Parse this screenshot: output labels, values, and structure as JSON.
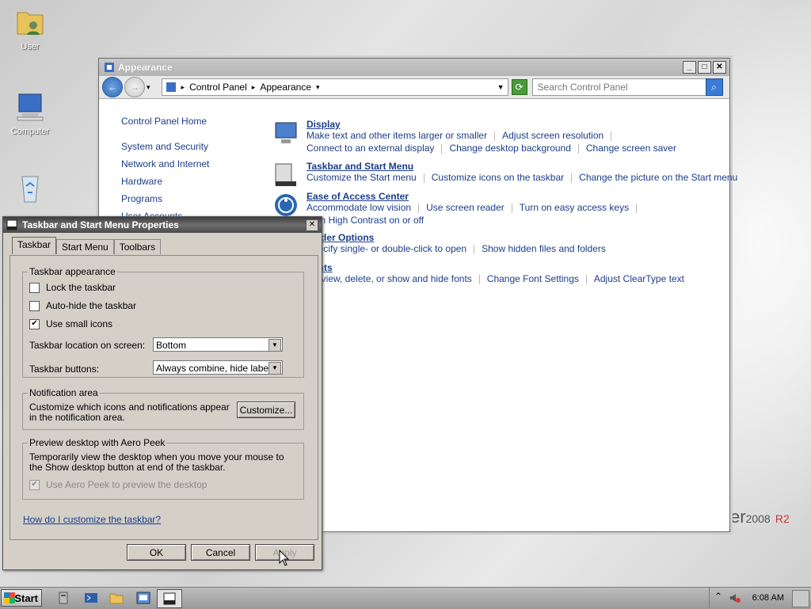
{
  "desktop": {
    "icons": [
      {
        "label": "User"
      },
      {
        "label": "Computer"
      },
      {
        "label": "Recycle Bin"
      }
    ],
    "brand": {
      "text": "er",
      "version": "2008",
      "edition": "R2"
    }
  },
  "control_panel": {
    "title": "Appearance",
    "breadcrumb": [
      "Control Panel",
      "Appearance"
    ],
    "search_placeholder": "Search Control Panel",
    "left_nav": {
      "home": "Control Panel Home",
      "items": [
        "System and Security",
        "Network and Internet",
        "Hardware",
        "Programs",
        "User Accounts"
      ]
    },
    "categories": [
      {
        "title": "Display",
        "rows": [
          [
            "Make text and other items larger or smaller",
            "Adjust screen resolution"
          ],
          [
            "Connect to an external display",
            "Change desktop background",
            "Change screen saver"
          ]
        ]
      },
      {
        "title": "Taskbar and Start Menu",
        "rows": [
          [
            "Customize the Start menu",
            "Customize icons on the taskbar",
            "Change the picture on the Start menu"
          ]
        ]
      },
      {
        "title": "Ease of Access Center",
        "rows": [
          [
            "Accommodate low vision",
            "Use screen reader",
            "Turn on easy access keys"
          ],
          [
            "Turn High Contrast on or off"
          ]
        ]
      },
      {
        "title": "Folder Options",
        "rows": [
          [
            "Specify single- or double-click to open",
            "Show hidden files and folders"
          ]
        ]
      },
      {
        "title": "Fonts",
        "rows": [
          [
            "Preview, delete, or show and hide fonts",
            "Change Font Settings",
            "Adjust ClearType text"
          ]
        ]
      }
    ]
  },
  "dialog": {
    "title": "Taskbar and Start Menu Properties",
    "tabs": [
      "Taskbar",
      "Start Menu",
      "Toolbars"
    ],
    "active_tab": "Taskbar",
    "appearance_group": {
      "label": "Taskbar appearance",
      "lock_label": "Lock the taskbar",
      "lock_checked": false,
      "autohide_label": "Auto-hide the taskbar",
      "autohide_checked": false,
      "small_icons_label": "Use small icons",
      "small_icons_checked": true,
      "location_label": "Taskbar location on screen:",
      "location_value": "Bottom",
      "buttons_label": "Taskbar buttons:",
      "buttons_value": "Always combine, hide labels"
    },
    "notification_group": {
      "label": "Notification area",
      "text": "Customize which icons and notifications appear in the notification area.",
      "customize_button": "Customize..."
    },
    "aero_group": {
      "label": "Preview desktop with Aero Peek",
      "text": "Temporarily view the desktop when you move your mouse to the Show desktop button at end of the taskbar.",
      "peek_label": "Use Aero Peek to preview the desktop",
      "peek_checked": true,
      "peek_enabled": false
    },
    "help_link": "How do I customize the taskbar?",
    "ok": "OK",
    "cancel": "Cancel",
    "apply": "Apply"
  },
  "taskbar": {
    "start_label": "Start",
    "clock": "6:08 AM"
  },
  "colors": {
    "link": "#1c3d8a",
    "dialog_bg": "#d4d0c8"
  }
}
